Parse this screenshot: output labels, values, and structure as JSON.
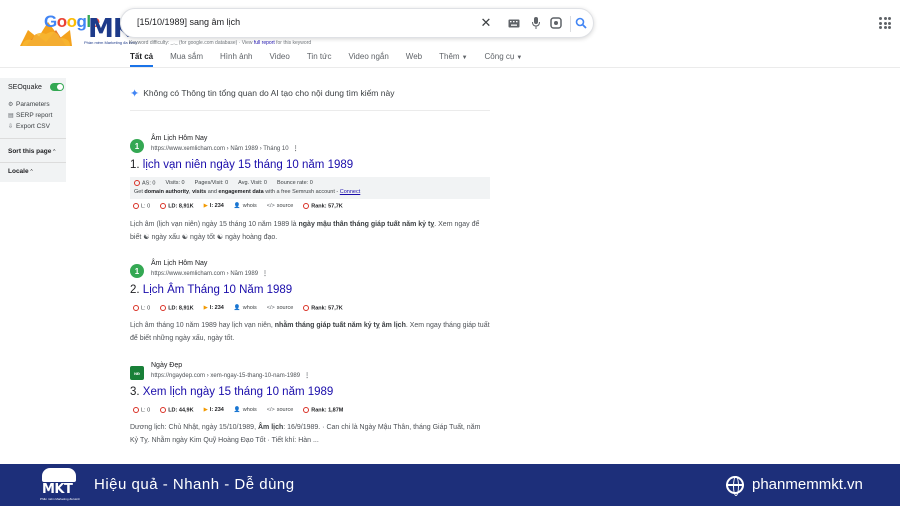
{
  "logo": {
    "google_text": "Google",
    "brand": "MKT",
    "tagline": "Phần mềm Marketing đa kênh"
  },
  "search": {
    "query": "[15/10/1989] sang âm lịch"
  },
  "seo_meta": {
    "text": "Keyword difficulty: _._ (for google.com database) · View",
    "link": "full report",
    "suffix": "for this keyword"
  },
  "tabs": [
    {
      "label": "Tất cả"
    },
    {
      "label": "Mua sắm"
    },
    {
      "label": "Hình ảnh"
    },
    {
      "label": "Video"
    },
    {
      "label": "Tin tức"
    },
    {
      "label": "Video ngắn"
    },
    {
      "label": "Web"
    },
    {
      "label": "Thêm"
    },
    {
      "label": "Công cụ"
    }
  ],
  "seoquake": {
    "title": "SEOquake",
    "items": [
      "Parameters",
      "SERP report",
      "Export CSV"
    ],
    "sort_label": "Sort this page",
    "locale_label": "Locale"
  },
  "ai_overview": "Không có Thông tin tổng quan do AI tạo cho nội dung tìm kiếm này",
  "results": [
    {
      "favicon": "1",
      "site": "Âm Lịch Hôm Nay",
      "url": "https://www.xemlicham.com › Năm 1989 › Tháng 10",
      "number": "1.",
      "title": "lịch vạn niên ngày 15 tháng 10 năm 1989",
      "metrics_top": {
        "as": "AS: 0",
        "visits": "Visits: 0",
        "pages": "Pages/Visit: 0",
        "avg": "Avg. Visit: 0",
        "bounce": "Bounce rate: 0"
      },
      "semrush_note": {
        "pre": "Get",
        "b1": "domain authority",
        "mid": ",",
        "b2": "visits",
        "and": "and",
        "b3": "engagement data",
        "post": "with a free Semrush account -",
        "link": "Connect"
      },
      "metrics": {
        "l": "L: 0",
        "ld": "LD: 8,91K",
        "i": "I: 234",
        "whois": "whois",
        "source": "source",
        "rank": "Rank: 57,7K"
      },
      "snippet_a": "Lịch âm (lịch vạn niên) ngày 15 tháng 10 năm 1989 là ",
      "snippet_b": "ngày mậu thân tháng giáp tuất năm kỷ tỵ",
      "snippet_c": ". Xem ngay để biết ☯ ngày xấu ☯ ngày tốt ☯ ngày hoàng đạo."
    },
    {
      "favicon": "1",
      "site": "Âm Lịch Hôm Nay",
      "url": "https://www.xemlicham.com › Năm 1989",
      "number": "2.",
      "title": "Lịch Âm Tháng 10 Năm 1989",
      "metrics": {
        "l": "L: 0",
        "ld": "LD: 8,91K",
        "i": "I: 234",
        "whois": "whois",
        "source": "source",
        "rank": "Rank: 57,7K"
      },
      "snippet_a": "Lịch âm tháng 10 năm 1989 hay lịch vạn niên, ",
      "snippet_b": "nhằm tháng giáp tuất năm kỷ tỵ âm lịch",
      "snippet_c": ". Xem ngay tháng giáp tuất để biết những ngày xấu, ngày tốt."
    },
    {
      "favicon": "NĐ",
      "site": "Ngày Đẹp",
      "url": "https://ngaydep.com › xem-ngay-15-thang-10-nam-1989",
      "number": "3.",
      "title": "Xem lịch ngày 15 tháng 10 năm 1989",
      "metrics": {
        "l": "L: 0",
        "ld": "LD: 44,9K",
        "i": "I: 234",
        "whois": "whois",
        "source": "source",
        "rank": "Rank: 1,87M"
      },
      "snippet_a": "Dương lịch: Chủ Nhật, ngày 15/10/1989, ",
      "snippet_b": "Âm lịch",
      "snippet_c": ": 16/9/1989. · Can chi là Ngày Mậu Thân, tháng Giáp Tuất, năm Kỷ Tỵ. Nhằm ngày Kim Quỹ Hoàng Đạo Tốt · Tiết khí: Hàn ..."
    }
  ],
  "footer": {
    "logo_text": "MKT",
    "logo_sub": "Phần mềm Marketing đa kênh",
    "slogan": "Hiệu quả - Nhanh - Dễ dùng",
    "website": "phanmemmkt.vn"
  }
}
